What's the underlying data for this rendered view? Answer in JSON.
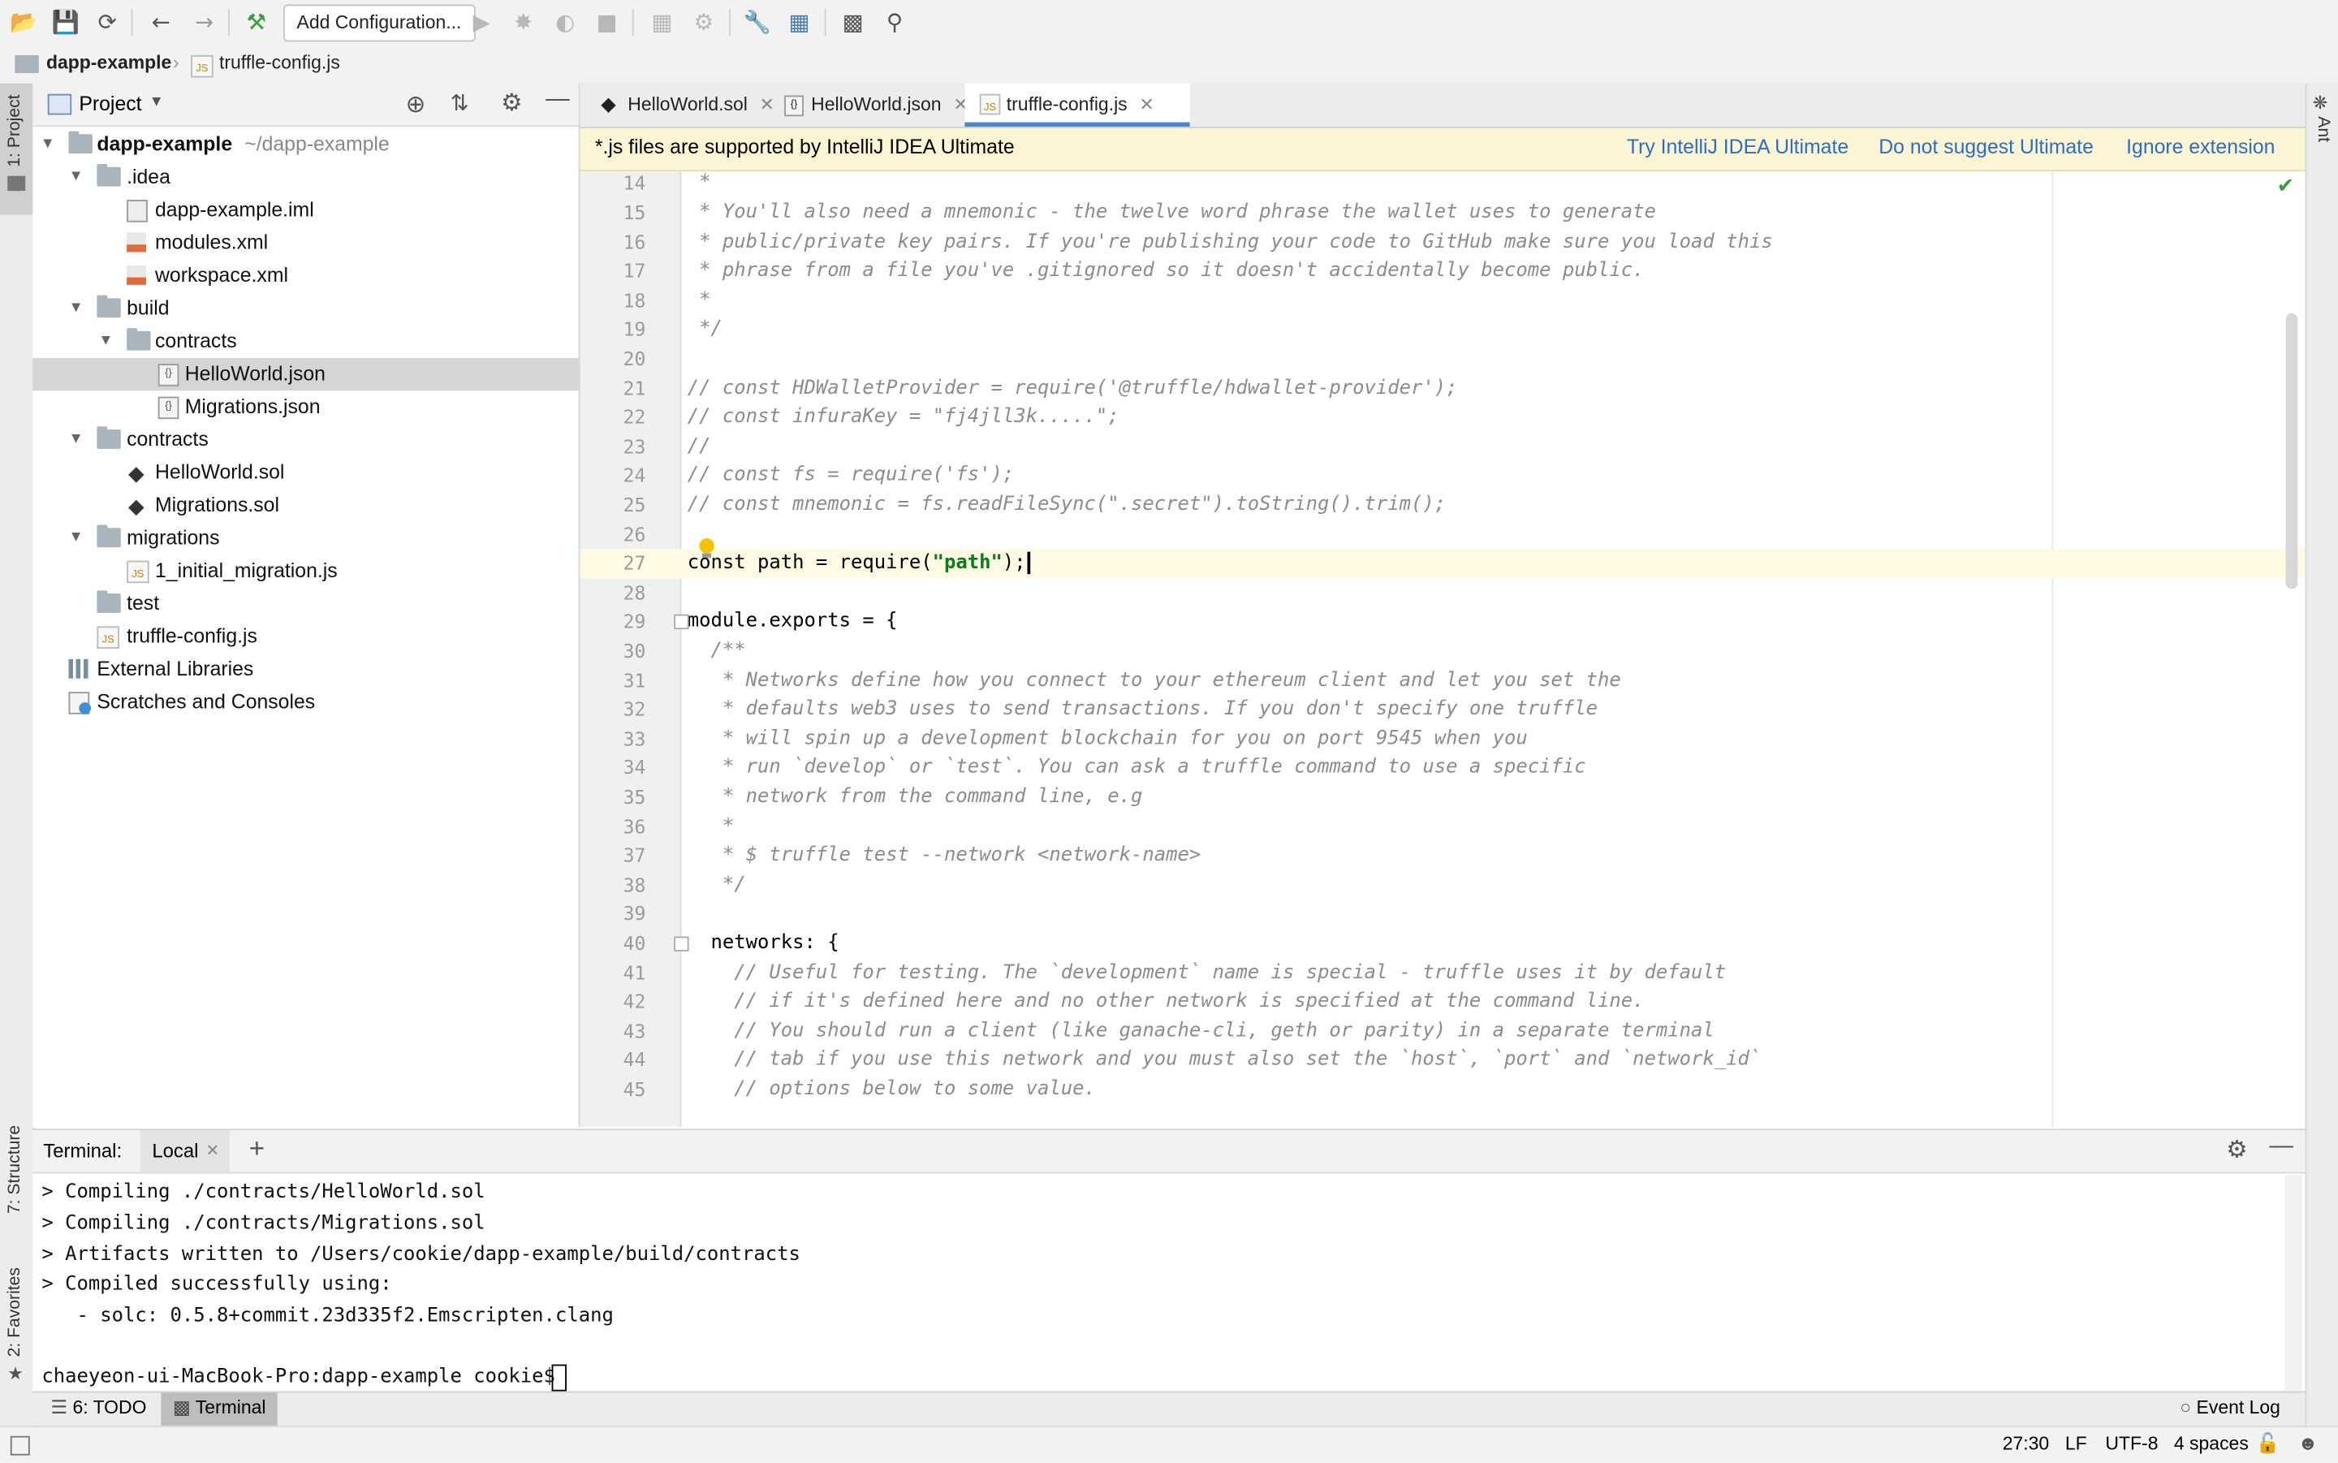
{
  "toolbar": {
    "add_configuration": "Add Configuration..."
  },
  "breadcrumb": {
    "project": "dapp-example",
    "file": "truffle-config.js"
  },
  "side_strips": {
    "left_top": "1: Project",
    "left_mid": "7: Structure",
    "left_bottom": "2: Favorites",
    "right_top": "Ant"
  },
  "project_panel": {
    "title": "Project",
    "tree": [
      {
        "label": "dapp-example",
        "suffix": "~/dapp-example",
        "type": "folder",
        "expanded": true
      },
      {
        "label": ".idea",
        "type": "folder",
        "expanded": true
      },
      {
        "label": "dapp-example.iml",
        "type": "iml"
      },
      {
        "label": "modules.xml",
        "type": "xml"
      },
      {
        "label": "workspace.xml",
        "type": "xml"
      },
      {
        "label": "build",
        "type": "folder",
        "expanded": true
      },
      {
        "label": "contracts",
        "type": "folder",
        "expanded": true
      },
      {
        "label": "HelloWorld.json",
        "type": "json",
        "selected": true
      },
      {
        "label": "Migrations.json",
        "type": "json"
      },
      {
        "label": "contracts",
        "type": "folder",
        "expanded": true
      },
      {
        "label": "HelloWorld.sol",
        "type": "sol"
      },
      {
        "label": "Migrations.sol",
        "type": "sol"
      },
      {
        "label": "migrations",
        "type": "folder",
        "expanded": true
      },
      {
        "label": "1_initial_migration.js",
        "type": "js"
      },
      {
        "label": "test",
        "type": "folder"
      },
      {
        "label": "truffle-config.js",
        "type": "js"
      },
      {
        "label": "External Libraries",
        "type": "lib"
      },
      {
        "label": "Scratches and Consoles",
        "type": "scratch"
      }
    ]
  },
  "tabs": [
    {
      "label": "HelloWorld.sol",
      "icon": "ethereum-icon"
    },
    {
      "label": "HelloWorld.json",
      "icon": "json-icon"
    },
    {
      "label": "truffle-config.js",
      "icon": "js-icon",
      "active": true
    }
  ],
  "banner": {
    "message": "*.js files are supported by IntelliJ IDEA Ultimate",
    "try_link": "Try IntelliJ IDEA Ultimate",
    "dismiss_link": "Do not suggest Ultimate",
    "ignore_link": "Ignore extension"
  },
  "editor": {
    "current_line": 27,
    "lines": [
      {
        "n": "14",
        "text": " *"
      },
      {
        "n": "15",
        "text": " * You'll also need a mnemonic - the twelve word phrase the wallet uses to generate"
      },
      {
        "n": "16",
        "text": " * public/private key pairs. If you're publishing your code to GitHub make sure you load this"
      },
      {
        "n": "17",
        "text": " * phrase from a file you've .gitignored so it doesn't accidentally become public."
      },
      {
        "n": "18",
        "text": " *"
      },
      {
        "n": "19",
        "text": " */"
      },
      {
        "n": "20",
        "text": ""
      },
      {
        "n": "21",
        "text": "// const HDWalletProvider = require('@truffle/hdwallet-provider');"
      },
      {
        "n": "22",
        "text": "// const infuraKey = \"fj4jll3k.....\";"
      },
      {
        "n": "23",
        "text": "//"
      },
      {
        "n": "24",
        "text": "// const fs = require('fs');"
      },
      {
        "n": "25",
        "text": "// const mnemonic = fs.readFileSync(\".secret\").toString().trim();"
      },
      {
        "n": "26",
        "text": ""
      },
      {
        "n": "27",
        "pre": "const path = require(",
        "str": "\"path\"",
        "post": ");"
      },
      {
        "n": "28",
        "text": ""
      },
      {
        "n": "29",
        "code": "module.exports = {"
      },
      {
        "n": "30",
        "text": "  /**"
      },
      {
        "n": "31",
        "text": "   * Networks define how you connect to your ethereum client and let you set the"
      },
      {
        "n": "32",
        "text": "   * defaults web3 uses to send transactions. If you don't specify one truffle"
      },
      {
        "n": "33",
        "text": "   * will spin up a development blockchain for you on port 9545 when you"
      },
      {
        "n": "34",
        "text": "   * run `develop` or `test`. You can ask a truffle command to use a specific"
      },
      {
        "n": "35",
        "text": "   * network from the command line, e.g"
      },
      {
        "n": "36",
        "text": "   *"
      },
      {
        "n": "37",
        "text": "   * $ truffle test --network <network-name>"
      },
      {
        "n": "38",
        "text": "   */"
      },
      {
        "n": "39",
        "text": ""
      },
      {
        "n": "40",
        "code": "  networks: {"
      },
      {
        "n": "41",
        "text": "    // Useful for testing. The `development` name is special - truffle uses it by default"
      },
      {
        "n": "42",
        "text": "    // if it's defined here and no other network is specified at the command line."
      },
      {
        "n": "43",
        "text": "    // You should run a client (like ganache-cli, geth or parity) in a separate terminal"
      },
      {
        "n": "44",
        "text": "    // tab if you use this network and you must also set the `host`, `port` and `network_id`"
      },
      {
        "n": "45",
        "text": "    // options below to some value."
      }
    ]
  },
  "terminal": {
    "title": "Terminal:",
    "tab": "Local",
    "lines": [
      "> Compiling ./contracts/HelloWorld.sol",
      "> Compiling ./contracts/Migrations.sol",
      "> Artifacts written to /Users/cookie/dapp-example/build/contracts",
      "> Compiled successfully using:",
      "   - solc: 0.5.8+commit.23d335f2.Emscripten.clang",
      "",
      "chaeyeon-ui-MacBook-Pro:dapp-example cookie$ "
    ]
  },
  "bottom_tools": {
    "todo": "6: TODO",
    "terminal": "Terminal",
    "event_log": "Event Log"
  },
  "status": {
    "position": "27:30",
    "line_sep": "LF",
    "encoding": "UTF-8",
    "indent": "4 spaces"
  }
}
